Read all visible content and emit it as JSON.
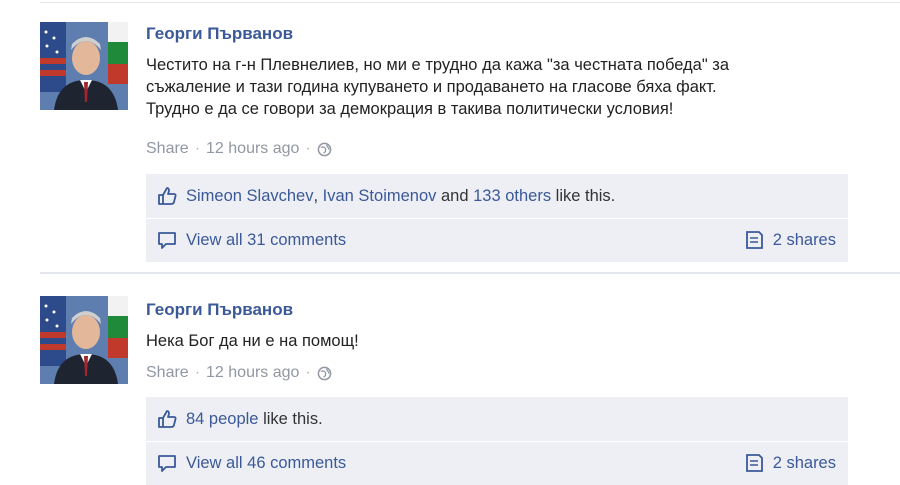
{
  "posts": [
    {
      "author": "Георги Първанов",
      "message_lines": [
        "Честито на г-н Плевнелиев, но ми е трудно да кажа \"за честната победа\" за",
        "съжаление и тази година купуването и продаването на гласове бяха факт.",
        "Трудно е да се говори за демокрация в такива политически условия!"
      ],
      "share_label": "Share",
      "time": "12 hours ago",
      "likes": {
        "name1": "Simeon Slavchev",
        "comma": ", ",
        "name2": "Ivan Stoimenov",
        "and": " and ",
        "others": "133 others",
        "suffix": " like this."
      },
      "comments_label": "View all 31 comments",
      "shares_label": "2 shares"
    },
    {
      "author": "Георги Първанов",
      "message_lines": [
        "Нека Бог да ни е на помощ!"
      ],
      "share_label": "Share",
      "time": "12 hours ago",
      "likes": {
        "people": "84 people",
        "suffix": " like this."
      },
      "comments_label": "View all 46 comments",
      "shares_label": "2 shares"
    }
  ],
  "icons": {
    "like": "thumbs-up-icon",
    "comment": "comment-icon",
    "share": "share-icon",
    "privacy": "globe-icon"
  },
  "colors": {
    "link": "#3b5998",
    "meta": "#9197a3",
    "box": "#edeff4"
  }
}
